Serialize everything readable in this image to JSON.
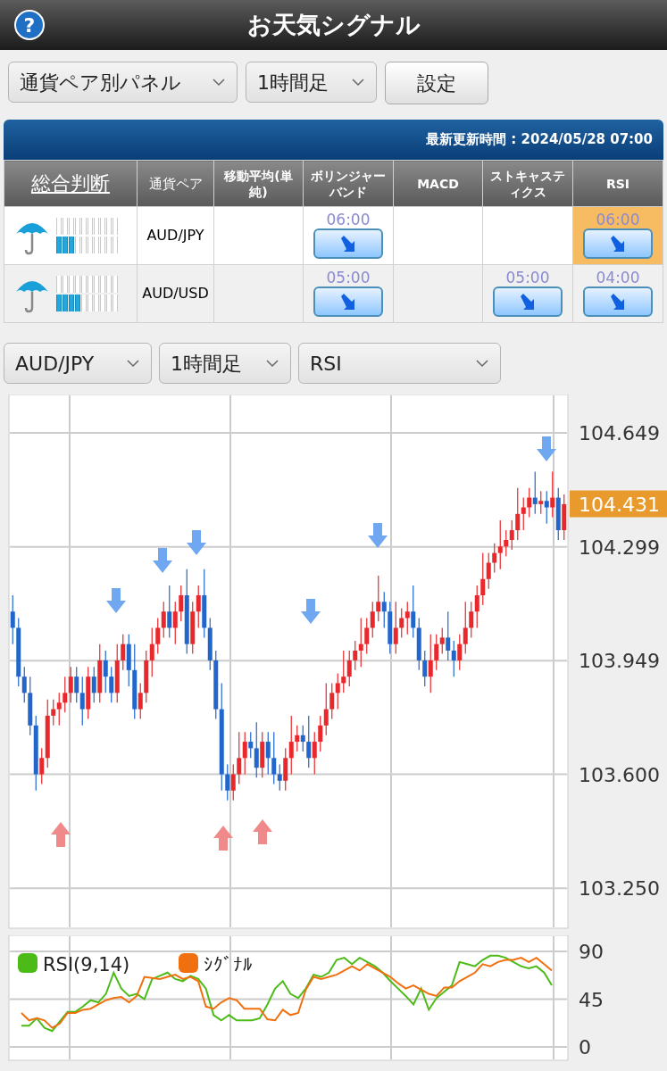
{
  "header": {
    "help": "?",
    "title": "お天気シグナル"
  },
  "toolbar": {
    "panel_select": "通貨ペア別パネル",
    "timeframe_select": "1時間足",
    "settings_button": "設定"
  },
  "signal_table": {
    "updated": "最新更新時間 : 2024/05/28 07:00",
    "columns": [
      "総合判断",
      "通貨ペア",
      "移動平均(単純)",
      "ボリンジャーバンド",
      "MACD",
      "ストキャスティクス",
      "RSI"
    ],
    "rows": [
      {
        "cells": [
          {
            "kind": "overall",
            "level": 0.3
          },
          {
            "kind": "pair",
            "text": "AUD/JPY"
          },
          {
            "kind": "blank"
          },
          {
            "kind": "down",
            "time": "06:00",
            "highlighted": false
          },
          {
            "kind": "blank"
          },
          {
            "kind": "blank"
          },
          {
            "kind": "down",
            "time": "06:00",
            "highlighted": true
          }
        ]
      },
      {
        "cells": [
          {
            "kind": "overall",
            "level": 0.4
          },
          {
            "kind": "pair",
            "text": "AUD/USD"
          },
          {
            "kind": "blank"
          },
          {
            "kind": "down",
            "time": "05:00",
            "highlighted": false
          },
          {
            "kind": "blank"
          },
          {
            "kind": "down",
            "time": "05:00",
            "highlighted": false
          },
          {
            "kind": "down",
            "time": "04:00",
            "highlighted": false
          }
        ]
      }
    ]
  },
  "chart_controls": {
    "pair": "AUD/JPY",
    "timeframe": "1時間足",
    "indicator": "RSI"
  },
  "price_chart": {
    "current_price": "104.431",
    "chart_data": {
      "type": "candlestick",
      "grid": true,
      "ylim": [
        103.127,
        104.767
      ],
      "yticks": [
        {
          "value": 104.649,
          "label": "104.649"
        },
        {
          "value": 104.299,
          "label": "104.299"
        },
        {
          "value": 103.949,
          "label": "103.949"
        },
        {
          "value": 103.6,
          "label": "103.600"
        },
        {
          "value": 103.25,
          "label": "103.250"
        }
      ],
      "ohlc": [
        [
          104.1,
          104.15,
          104.0,
          104.05
        ],
        [
          104.05,
          104.08,
          103.87,
          103.9
        ],
        [
          103.9,
          103.93,
          103.82,
          103.85
        ],
        [
          103.85,
          103.9,
          103.72,
          103.75
        ],
        [
          103.75,
          103.78,
          103.55,
          103.6
        ],
        [
          103.6,
          103.68,
          103.57,
          103.65
        ],
        [
          103.65,
          103.83,
          103.62,
          103.78
        ],
        [
          103.78,
          103.83,
          103.75,
          103.8
        ],
        [
          103.8,
          103.85,
          103.75,
          103.82
        ],
        [
          103.82,
          103.9,
          103.79,
          103.85
        ],
        [
          103.85,
          103.93,
          103.82,
          103.9
        ],
        [
          103.9,
          103.93,
          103.82,
          103.85
        ],
        [
          103.85,
          103.9,
          103.75,
          103.8
        ],
        [
          103.8,
          103.93,
          103.77,
          103.9
        ],
        [
          103.9,
          103.93,
          103.82,
          103.85
        ],
        [
          103.85,
          104.0,
          103.82,
          103.95
        ],
        [
          103.95,
          103.98,
          103.85,
          103.9
        ],
        [
          103.9,
          103.93,
          103.82,
          103.85
        ],
        [
          103.85,
          104.0,
          103.82,
          103.95
        ],
        [
          103.95,
          104.03,
          103.92,
          104.0
        ],
        [
          104.0,
          104.03,
          103.87,
          103.92
        ],
        [
          103.92,
          104.0,
          103.77,
          103.8
        ],
        [
          103.8,
          103.88,
          103.77,
          103.85
        ],
        [
          103.85,
          103.98,
          103.82,
          103.95
        ],
        [
          103.95,
          104.05,
          103.9,
          104.0
        ],
        [
          104.0,
          104.08,
          103.97,
          104.05
        ],
        [
          104.05,
          104.13,
          104.02,
          104.1
        ],
        [
          104.1,
          104.18,
          104.02,
          104.05
        ],
        [
          104.05,
          104.13,
          104.0,
          104.1
        ],
        [
          104.1,
          104.18,
          104.07,
          104.15
        ],
        [
          104.15,
          104.23,
          103.97,
          104.0
        ],
        [
          104.0,
          104.13,
          103.97,
          104.1
        ],
        [
          104.1,
          104.18,
          104.05,
          104.15
        ],
        [
          104.15,
          104.23,
          104.02,
          104.05
        ],
        [
          104.05,
          104.08,
          103.92,
          103.95
        ],
        [
          103.95,
          103.98,
          103.77,
          103.8
        ],
        [
          103.8,
          103.88,
          103.55,
          103.6
        ],
        [
          103.6,
          103.63,
          103.52,
          103.55
        ],
        [
          103.55,
          103.63,
          103.52,
          103.6
        ],
        [
          103.6,
          103.73,
          103.57,
          103.65
        ],
        [
          103.65,
          103.73,
          103.6,
          103.7
        ],
        [
          103.7,
          103.73,
          103.65,
          103.68
        ],
        [
          103.68,
          103.76,
          103.59,
          103.62
        ],
        [
          103.62,
          103.73,
          103.59,
          103.7
        ],
        [
          103.7,
          103.73,
          103.6,
          103.65
        ],
        [
          103.65,
          103.73,
          103.57,
          103.6
        ],
        [
          103.6,
          103.63,
          103.55,
          103.58
        ],
        [
          103.58,
          103.68,
          103.55,
          103.65
        ],
        [
          103.65,
          103.78,
          103.6,
          103.7
        ],
        [
          103.7,
          103.75,
          103.67,
          103.72
        ],
        [
          103.72,
          103.75,
          103.67,
          103.7
        ],
        [
          103.7,
          103.78,
          103.62,
          103.65
        ],
        [
          103.65,
          103.73,
          103.6,
          103.7
        ],
        [
          103.7,
          103.78,
          103.67,
          103.75
        ],
        [
          103.75,
          103.88,
          103.72,
          103.8
        ],
        [
          103.8,
          103.88,
          103.77,
          103.85
        ],
        [
          103.85,
          103.91,
          103.8,
          103.88
        ],
        [
          103.88,
          103.98,
          103.85,
          103.9
        ],
        [
          103.9,
          103.98,
          103.87,
          103.95
        ],
        [
          103.95,
          104.01,
          103.92,
          103.98
        ],
        [
          103.98,
          104.08,
          103.93,
          104.0
        ],
        [
          104.0,
          104.08,
          103.97,
          104.05
        ],
        [
          104.05,
          104.13,
          104.02,
          104.1
        ],
        [
          104.1,
          104.21,
          104.07,
          104.13
        ],
        [
          104.13,
          104.16,
          104.05,
          104.1
        ],
        [
          104.1,
          104.13,
          103.97,
          104.0
        ],
        [
          104.0,
          104.13,
          103.97,
          104.05
        ],
        [
          104.05,
          104.11,
          104.02,
          104.08
        ],
        [
          104.08,
          104.13,
          104.03,
          104.1
        ],
        [
          104.1,
          104.18,
          104.02,
          104.05
        ],
        [
          104.05,
          104.08,
          103.92,
          103.95
        ],
        [
          103.95,
          103.98,
          103.87,
          103.9
        ],
        [
          103.9,
          104.03,
          103.85,
          103.95
        ],
        [
          103.95,
          104.03,
          103.92,
          104.0
        ],
        [
          104.0,
          104.05,
          103.97,
          104.02
        ],
        [
          104.02,
          104.1,
          103.95,
          103.98
        ],
        [
          103.98,
          104.01,
          103.9,
          103.95
        ],
        [
          103.95,
          104.03,
          103.92,
          104.0
        ],
        [
          104.0,
          104.13,
          103.97,
          104.05
        ],
        [
          104.05,
          104.13,
          104.02,
          104.1
        ],
        [
          104.1,
          104.18,
          104.05,
          104.15
        ],
        [
          104.15,
          104.28,
          104.12,
          104.2
        ],
        [
          104.2,
          104.28,
          104.17,
          104.25
        ],
        [
          104.25,
          104.31,
          104.22,
          104.28
        ],
        [
          104.28,
          104.38,
          104.23,
          104.3
        ],
        [
          104.3,
          104.35,
          104.27,
          104.32
        ],
        [
          104.32,
          104.38,
          104.29,
          104.35
        ],
        [
          104.35,
          104.48,
          104.32,
          104.4
        ],
        [
          104.4,
          104.45,
          104.35,
          104.42
        ],
        [
          104.42,
          104.48,
          104.39,
          104.45
        ],
        [
          104.45,
          104.53,
          104.4,
          104.43
        ],
        [
          104.43,
          104.47,
          104.4,
          104.44
        ],
        [
          104.44,
          104.47,
          104.37,
          104.42
        ],
        [
          104.42,
          104.53,
          104.39,
          104.45
        ],
        [
          104.45,
          104.48,
          104.32,
          104.35
        ],
        [
          104.35,
          104.46,
          104.32,
          104.43
        ]
      ]
    }
  },
  "rsi_chart": {
    "chart_data": {
      "type": "line",
      "grid": true,
      "legend": true,
      "ylim": [
        0,
        90
      ],
      "yticks": [
        0,
        45,
        90
      ],
      "series": [
        {
          "name": "RSI(9,14)",
          "color": "#4cbb17",
          "values": [
            20,
            20,
            27,
            18,
            15,
            24,
            33,
            33,
            38,
            44,
            42,
            50,
            70,
            55,
            48,
            50,
            45,
            64,
            67,
            70,
            64,
            62,
            67,
            64,
            55,
            30,
            25,
            30,
            25,
            25,
            25,
            27,
            40,
            55,
            62,
            50,
            46,
            55,
            68,
            66,
            70,
            82,
            84,
            78,
            84,
            80,
            76,
            70,
            62,
            55,
            48,
            40,
            55,
            35,
            46,
            52,
            58,
            80,
            78,
            76,
            82,
            86,
            86,
            84,
            80,
            76,
            74,
            76,
            70,
            58
          ]
        },
        {
          "name": "ｼｸﾞﾅﾙ",
          "color": "#f07010",
          "values": [
            32,
            25,
            27,
            25,
            18,
            22,
            32,
            32,
            35,
            36,
            40,
            44,
            46,
            47,
            42,
            48,
            66,
            65,
            64,
            66,
            68,
            64,
            66,
            62,
            38,
            36,
            42,
            46,
            44,
            36,
            36,
            36,
            26,
            25,
            35,
            30,
            32,
            54,
            66,
            64,
            66,
            68,
            72,
            76,
            72,
            78,
            74,
            70,
            66,
            60,
            55,
            58,
            54,
            50,
            48,
            56,
            56,
            62,
            66,
            70,
            78,
            76,
            80,
            82,
            82,
            84,
            80,
            84,
            78,
            72
          ]
        }
      ]
    }
  }
}
